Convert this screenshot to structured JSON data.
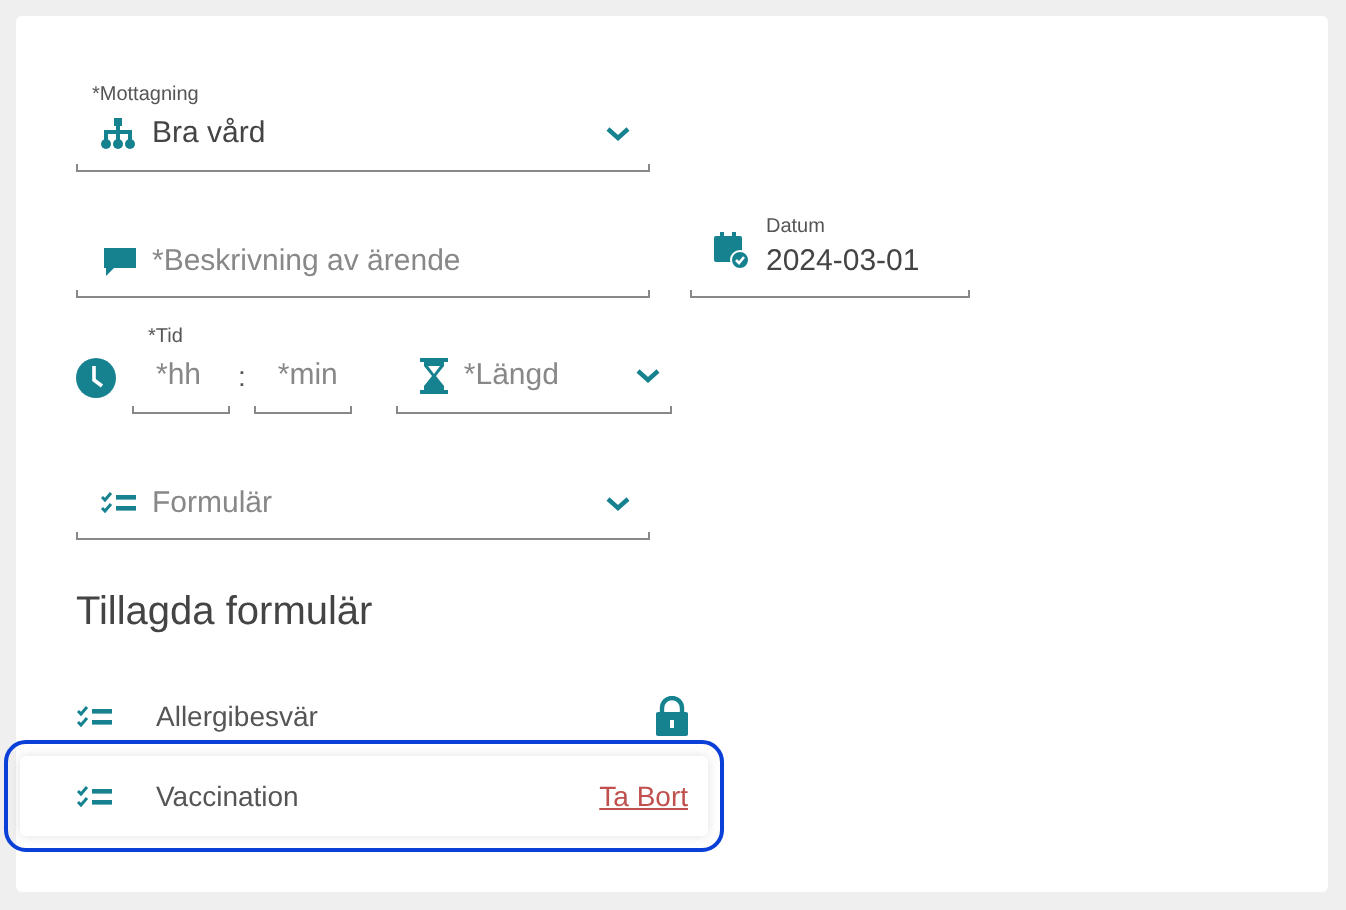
{
  "mottagning": {
    "label": "*Mottagning",
    "value": "Bra vård"
  },
  "beskrivning": {
    "placeholder": "*Beskrivning av ärende"
  },
  "datum": {
    "label": "Datum",
    "value": "2024-03-01"
  },
  "tid": {
    "label": "*Tid",
    "hours_placeholder": "*hh",
    "separator": ":",
    "minutes_placeholder": "*min"
  },
  "langd": {
    "placeholder": "*Längd"
  },
  "formular": {
    "placeholder": "Formulär"
  },
  "added_heading": "Tillagda formulär",
  "added_forms": [
    {
      "name": "Allergibesvär",
      "kind": "locked",
      "focused": false
    },
    {
      "name": "Vaccination",
      "kind": "removable",
      "action": "Ta Bort",
      "focused": true
    }
  ]
}
